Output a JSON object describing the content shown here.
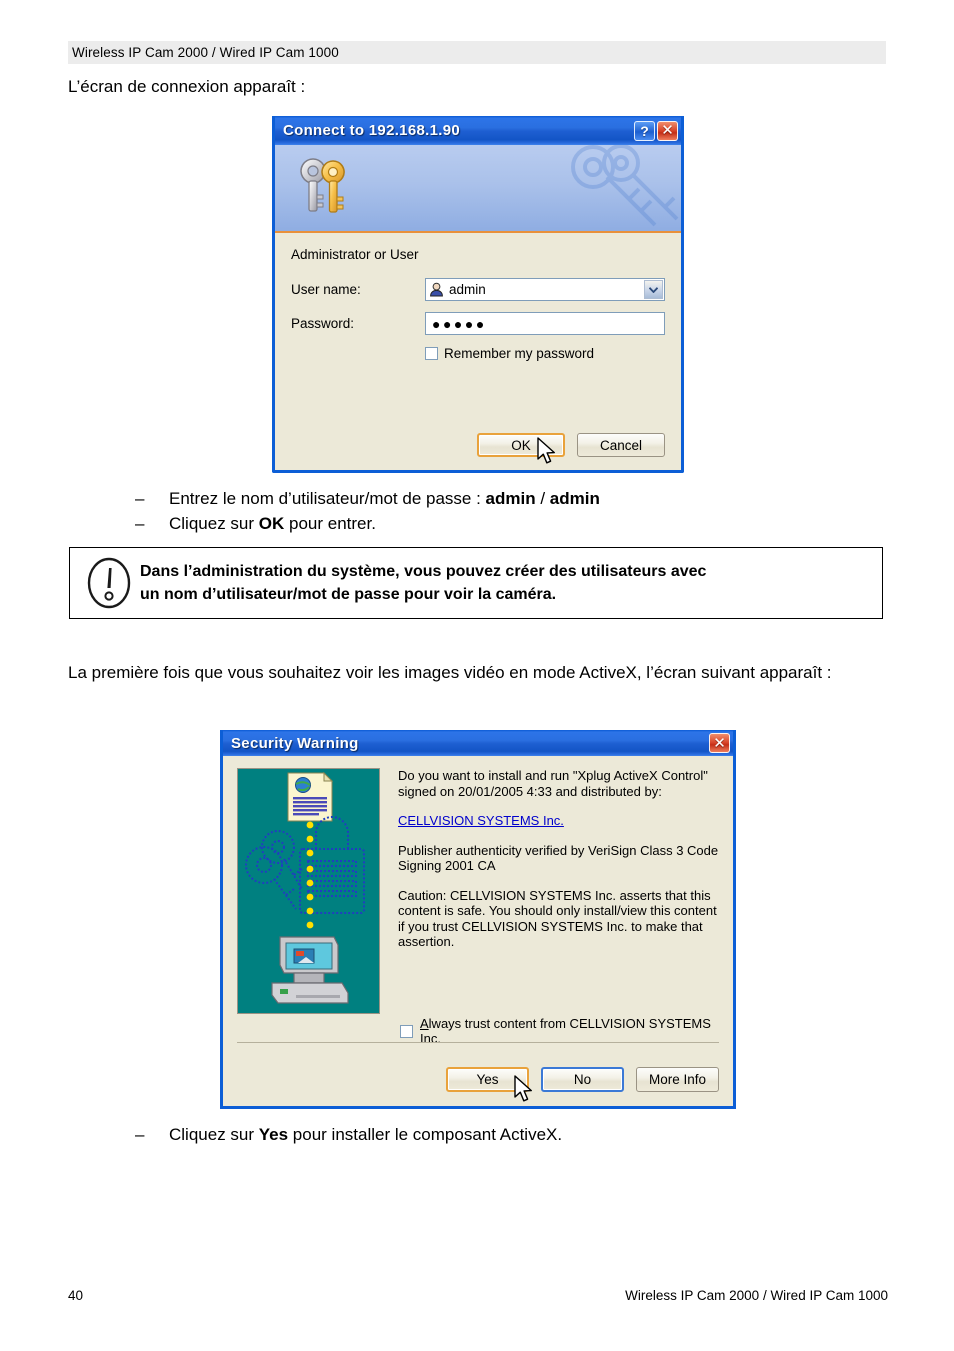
{
  "page": {
    "header_text": "Wireless IP Cam 2000 / Wired IP Cam 1000",
    "footer_page_number": "40",
    "footer_text": "Wireless IP Cam 2000 / Wired IP Cam 1000"
  },
  "intro": {
    "line1": "L’écran de connexion apparaît :",
    "line2": "La première fois que vous souhaitez voir les images vidéo en mode ActiveX, l’écran suivant apparaît :"
  },
  "bullets_login": [
    {
      "dash": "–",
      "text_before": "Entrez le nom d’utilisateur/mot de passe : ",
      "bold1": "admin",
      "middle": " / ",
      "bold2": "admin",
      "text_after": ""
    },
    {
      "dash": "–",
      "text_before": "Cliquez sur ",
      "bold1": "OK",
      "middle": " pour entrer.",
      "bold2": "",
      "text_after": ""
    }
  ],
  "bullets_activex": [
    {
      "dash": "–",
      "text_before": "Cliquez sur ",
      "bold1": "Yes",
      "middle": " pour installer le composant ActiveX.",
      "bold2": "",
      "text_after": ""
    }
  ],
  "note_box": {
    "icon": "exclamation-oval-icon",
    "line1": "Dans l’administration du système, vous pouvez créer des utilisateurs avec",
    "line2": "un nom d’utilisateur/mot de passe pour voir la caméra."
  },
  "connect_dialog": {
    "title": "Connect to 192.168.1.90",
    "help_glyph": "?",
    "close_glyph": "✕",
    "banner_icon": "keys-icon",
    "realm_caption": "Administrator or User",
    "username_label": "User name:",
    "username_value": "admin",
    "username_icon": "user-icon",
    "password_label": "Password:",
    "password_masked": "●●●●●",
    "remember_label": "Remember my password",
    "remember_checked": false,
    "ok_label": "OK",
    "cancel_label": "Cancel",
    "focused_button": "OK",
    "accent_rule_color": "#e8903a",
    "titlebar_color": "#1e5fd2"
  },
  "security_dialog": {
    "title": "Security Warning",
    "close_glyph": "✕",
    "graphic_name": "signed-content-lock-illustration",
    "graphic_bg": "#008080",
    "question": "Do you want to install and run \"Xplug ActiveX Control\" signed on 20/01/2005 4:33 and distributed by:",
    "publisher_link": "CELLVISION SYSTEMS Inc.",
    "publisher_link_color": "#0000cc",
    "authenticity": "Publisher authenticity verified by VeriSign Class 3 Code Signing 2001 CA",
    "caution": "Caution: CELLVISION SYSTEMS Inc. asserts that this content is safe.  You should only install/view this content if you trust CELLVISION SYSTEMS Inc. to make that assertion.",
    "always_trust_accel": "A",
    "always_trust_rest": "lways trust content from CELLVISION SYSTEMS Inc.",
    "always_trust_checked": false,
    "yes_label": "Yes",
    "no_label": "No",
    "more_info_label": "More Info",
    "focused_button": "Yes",
    "default_button": "No"
  }
}
